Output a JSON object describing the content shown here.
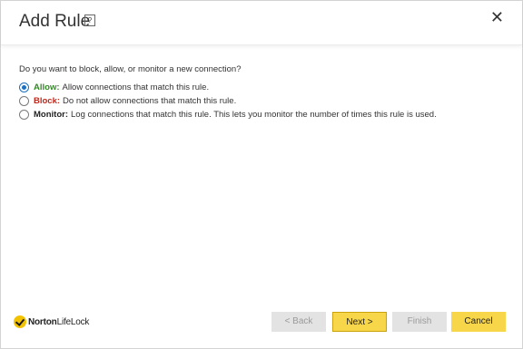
{
  "header": {
    "title": "Add Rule",
    "help_label": "?",
    "close_label": "✕"
  },
  "question": "Do you want to block, allow, or monitor a new connection?",
  "options": [
    {
      "name": "Allow:",
      "description": "Allow connections that match this rule.",
      "color": "#2e8b1f",
      "selected": true
    },
    {
      "name": "Block:",
      "description": "Do not allow connections that match this rule.",
      "color": "#c0281b",
      "selected": false
    },
    {
      "name": "Monitor:",
      "description": "Log connections that match this rule. This lets you monitor the number of times this rule is used.",
      "color": "#222222",
      "selected": false
    }
  ],
  "footer": {
    "logo_bold": "Norton",
    "logo_light": "LifeLock",
    "back_label": "< Back",
    "next_label": "Next >",
    "finish_label": "Finish",
    "cancel_label": "Cancel"
  },
  "colors": {
    "accent": "#f7d64a",
    "radio_selected": "#1b6ec2",
    "disabled_button": "#e3e3e3"
  }
}
